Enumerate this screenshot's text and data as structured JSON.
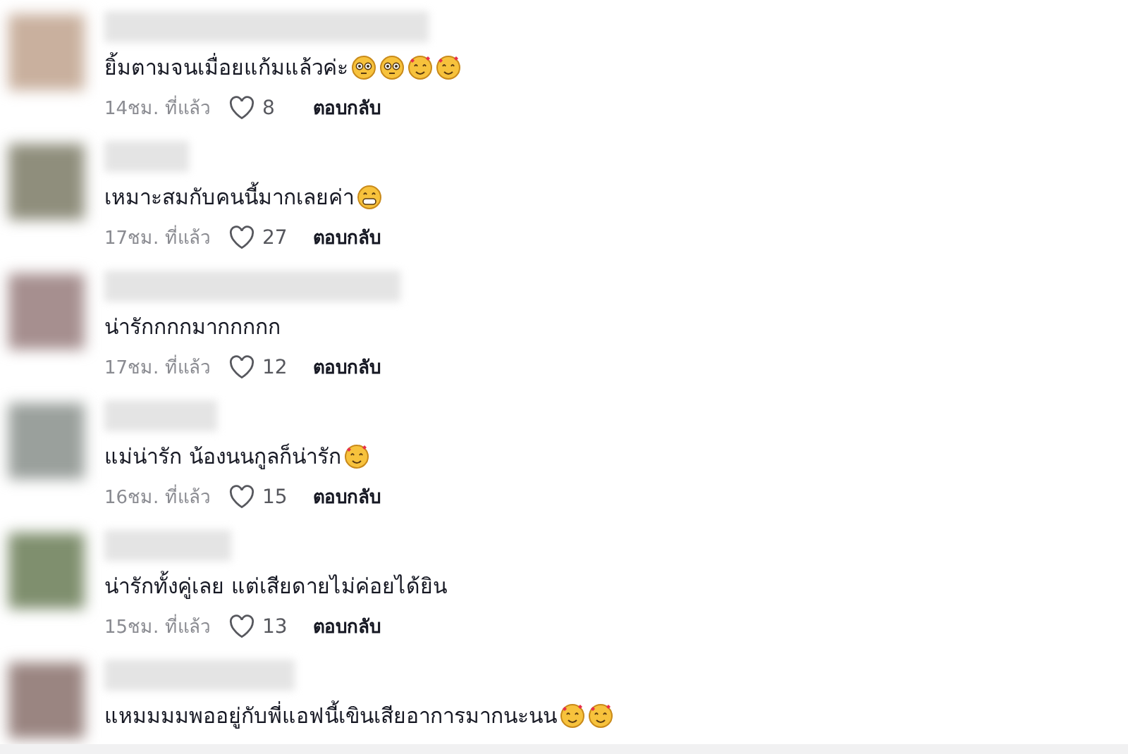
{
  "comments": [
    {
      "text": "ยิ้มตามจนเมื่อยแก้มแล้วค่ะ",
      "emojis": [
        {
          "kind": "flushed"
        },
        {
          "kind": "flushed"
        },
        {
          "kind": "hearts"
        },
        {
          "kind": "hearts"
        }
      ],
      "time": "14ชม. ที่แล้ว",
      "likes": "8",
      "reply": "ตอบกลับ"
    },
    {
      "text": "เหมาะสมกับคนนี้มากเลยค่า",
      "emojis": [
        {
          "kind": "grin"
        }
      ],
      "time": "17ชม. ที่แล้ว",
      "likes": "27",
      "reply": "ตอบกลับ"
    },
    {
      "text": "น่ารักกกกมากกกกก",
      "time": "17ชม. ที่แล้ว",
      "likes": "12",
      "reply": "ตอบกลับ"
    },
    {
      "text": "แม่น่ารัก น้องนนกูลก็น่ารัก",
      "emojis": [
        {
          "kind": "hearts"
        }
      ],
      "time": "16ชม. ที่แล้ว",
      "likes": "15",
      "reply": "ตอบกลับ"
    },
    {
      "text": "น่ารักทั้งคู่เลย แต่เสียดายไม่ค่อยได้ยิน",
      "time": "15ชม. ที่แล้ว",
      "likes": "13",
      "reply": "ตอบกลับ"
    },
    {
      "text": "แหมมมมพออยู่กับพี่แอฟนี้เขินเสียอาการมากนะนน",
      "emojis": [
        {
          "kind": "hearts"
        },
        {
          "kind": "hearts"
        }
      ]
    }
  ]
}
